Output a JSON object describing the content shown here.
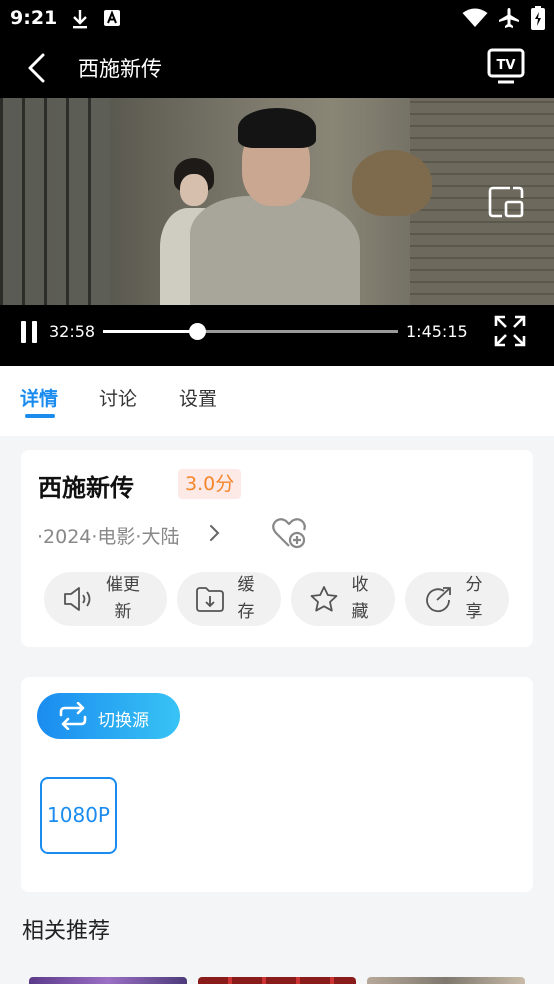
{
  "status_bar": {
    "time": "9:21",
    "icons": [
      "download-icon",
      "text-format-icon",
      "wifi-icon",
      "airplane-icon",
      "battery-icon"
    ]
  },
  "header": {
    "title": "西施新传",
    "icons": [
      "back-icon",
      "tv-cast-icon"
    ]
  },
  "player": {
    "current_time": "32:58",
    "total_time": "1:45:15",
    "progress": 0.32,
    "icons": [
      "pause-icon",
      "picture-in-picture-icon",
      "fullscreen-icon"
    ]
  },
  "tabs": [
    {
      "label": "详情",
      "active": true
    },
    {
      "label": "讨论",
      "active": false
    },
    {
      "label": "设置",
      "active": false
    }
  ],
  "detail": {
    "title": "西施新传",
    "score": "3.0分",
    "meta": "·2024·电影·大陆",
    "actions": [
      {
        "line1": "催更",
        "line2": "新",
        "icon": "speaker-icon"
      },
      {
        "line1": "缓",
        "line2": "存",
        "icon": "download-folder-icon"
      },
      {
        "line1": "收",
        "line2": "藏",
        "icon": "star-icon"
      },
      {
        "line1": "分",
        "line2": "享",
        "icon": "share-icon"
      }
    ]
  },
  "source": {
    "switch_label": "切换源",
    "resolution": "1080P"
  },
  "recommend": {
    "title": "相关推荐"
  },
  "colors": {
    "accent": "#1a8cf0",
    "score_text": "#f4862c",
    "score_bg": "#fde9e6",
    "page_bg": "#f4f5f7"
  }
}
